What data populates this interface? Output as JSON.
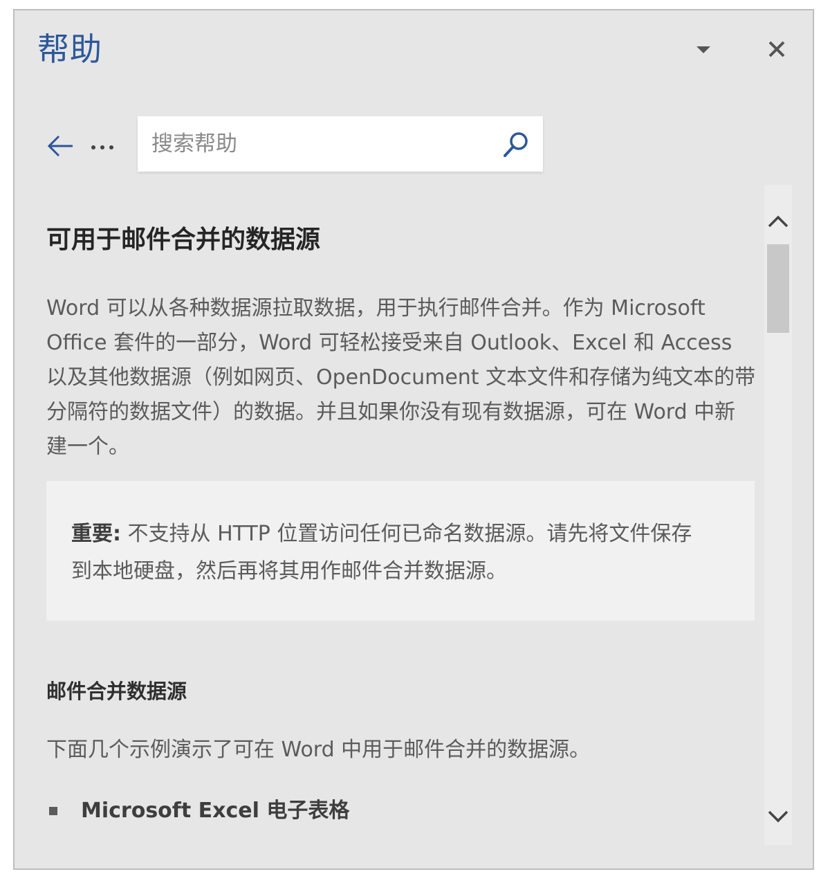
{
  "pane": {
    "title": "帮助",
    "dropdown_icon": "triangle-down-icon",
    "close_icon": "close-icon"
  },
  "nav": {
    "back_icon": "arrow-left-icon",
    "more_icon": "ellipsis-icon"
  },
  "search": {
    "placeholder": "搜索帮助",
    "value": "",
    "icon": "search-icon"
  },
  "article": {
    "title": "可用于邮件合并的数据源",
    "intro": "Word 可以从各种数据源拉取数据，用于执行邮件合并。作为 Microsoft Office 套件的一部分，Word 可轻松接受来自 Outlook、Excel 和 Access 以及其他数据源（例如网页、OpenDocument 文本文件和存储为纯文本的带分隔符的数据文件）的数据。并且如果你没有现有数据源，可在 Word 中新建一个。",
    "note_label": "重要:",
    "note_text": " 不支持从 HTTP 位置访问任何已命名数据源。请先将文件保存到本地硬盘，然后再将其用作邮件合并数据源。",
    "section_title": "邮件合并数据源",
    "section_intro": "下面几个示例演示了可在 Word 中用于邮件合并的数据源。",
    "list_items": [
      "Microsoft Excel 电子表格"
    ]
  },
  "scrollbar": {
    "position_fraction": 0.0,
    "visible_fraction": 0.14,
    "up_icon": "chevron-up-icon",
    "down_icon": "chevron-down-icon"
  },
  "colors": {
    "accent": "#2b579a",
    "pane_bg": "#e6e6e6",
    "note_bg": "#f1f1f1",
    "body_text": "#5b5b5b"
  }
}
